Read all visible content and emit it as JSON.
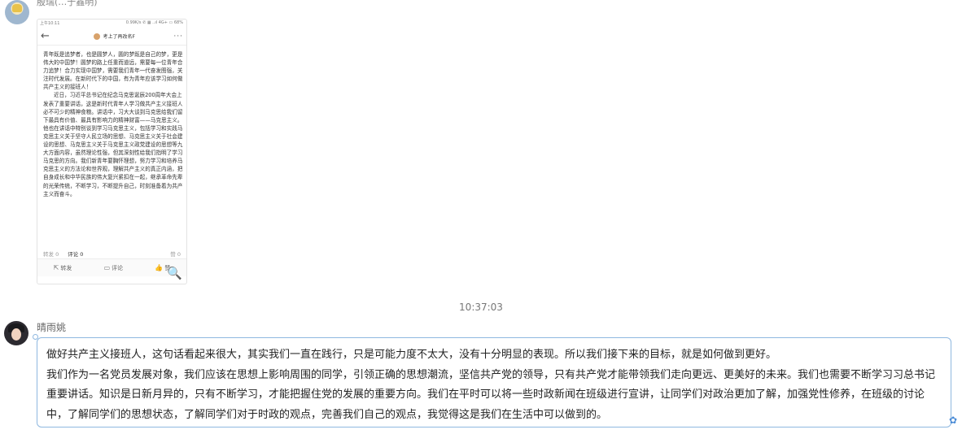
{
  "message1": {
    "sender": "殷瑞(…于鑫明)",
    "shared_post": {
      "status_left": "上午10:11",
      "status_right": "0.99K/s ✆ ▦ ..ıl 4G+ ▭ 68%",
      "title": "考上了再改名F",
      "paragraphs": [
        "青年既是追梦者，也是圆梦人，圆的梦既是自己的梦，更是伟大的中国梦！圆梦的路上任重而道远，需要每一位青年合力追梦！合力实现中国梦，需要我们青年一代奋发图强，关注时代发展。在新时代下的中国，有为青年应该学习如何做共产主义的接班人！",
        "近日，习近平总书记在纪念马克思诞辰200周年大会上发表了重要讲话，这是新时代青年人学习做共产主义接班人必不可少的精神食粮。讲话中，习大大谈到马克思给我们留下最具有价值、最具有影响力的精神财富——马克思主义。他也在讲话中特别谈到学习马克思主义，包括学习和实践马克思主义关于坚守人民立场的思想、马克思主义关于社会建设的思想、马克思主义关于马克思主义政党建设的思想等九大方面内容，虽然理论性强，但其深刻性给我们指明了学习马克思的方向。我们新青年要胸怀理想，努力学习和培养马克思主义的方法论和世界观，理解共产主义的真正内涵，把自身成长和中华民族的伟大复兴紧扣在一起，继承革命先辈的光荣传统，不断学习，不断提升自己，时刻准备着为共产主义而奋斗。"
      ],
      "stats": {
        "repost": "转发 0",
        "comment": "评论 0",
        "like": "赞 0"
      },
      "actions": {
        "repost": "转发",
        "comment": "评论",
        "like": "赞"
      }
    }
  },
  "time": "10:37:03",
  "message2": {
    "sender": "晴雨姚",
    "paragraphs": [
      "做好共产主义接班人，这句话看起来很大，其实我们一直在践行，只是可能力度不太大，没有十分明显的表现。所以我们接下来的目标，就是如何做到更好。",
      "我们作为一名党员发展对象，我们应该在思想上影响周围的同学，引领正确的思想潮流，坚信共产党的领导，只有共产党才能带领我们走向更远、更美好的未来。我们也需要不断学习习总书记重要讲话。知识是日新月异的，只有不断学习，才能把握住党的发展的重要方向。我们在平时可以将一些时政新闻在班级进行宣讲，让同学们对政治更加了解，加强党性修养，在班级的讨论中，了解同学们的思想状态，了解同学们对于时政的观点，完善我们自己的观点，我觉得这是我们在生活中可以做到的。"
    ]
  }
}
